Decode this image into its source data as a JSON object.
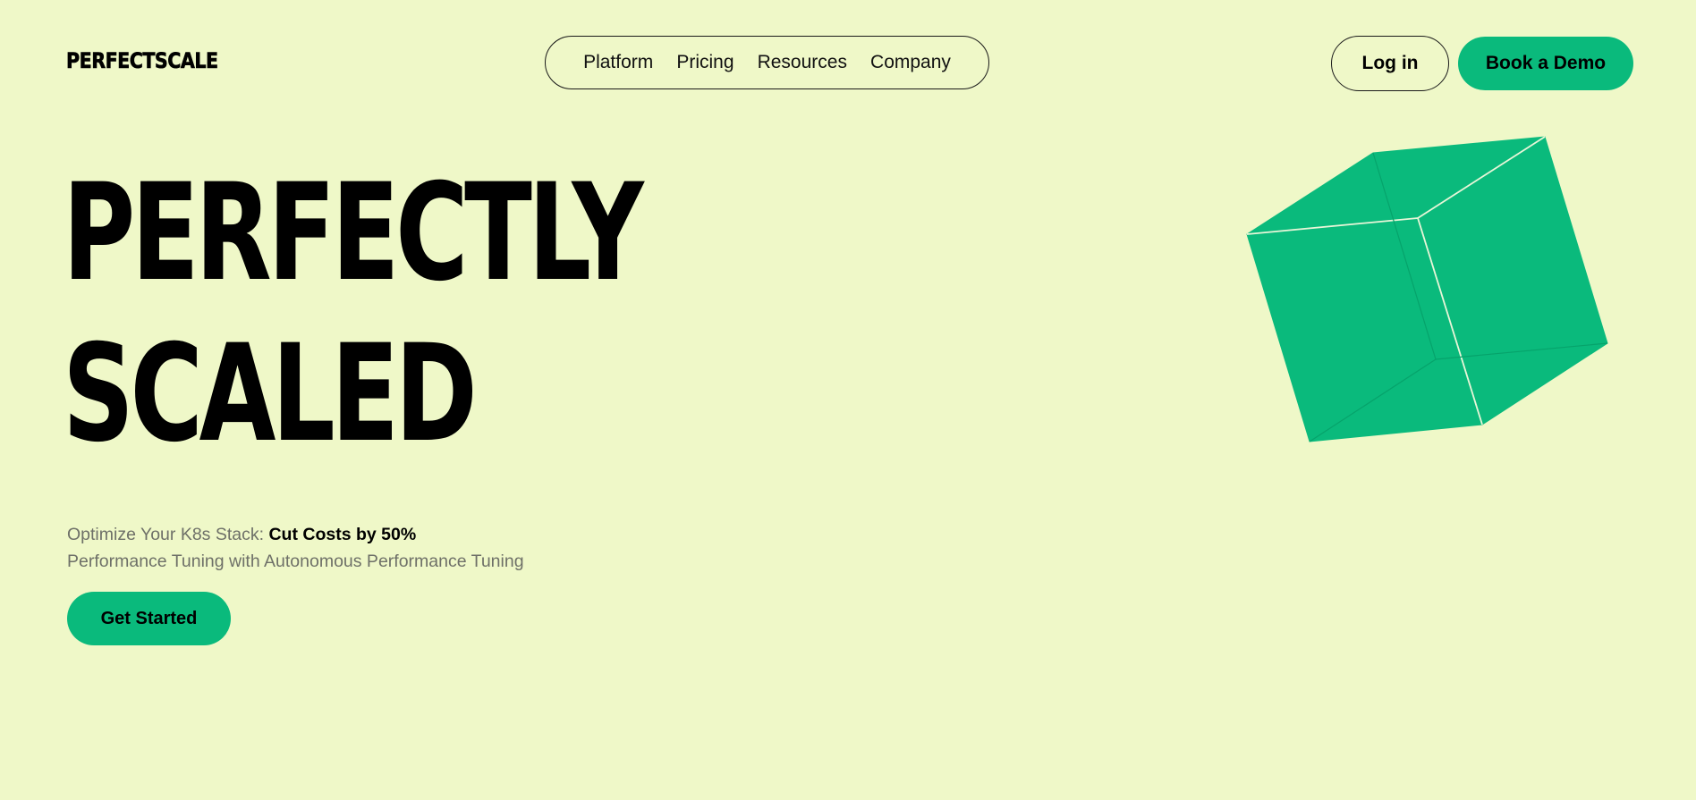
{
  "header": {
    "logo_text": "PERFECTSCALE",
    "nav_items": [
      {
        "label": "Platform"
      },
      {
        "label": "Pricing"
      },
      {
        "label": "Resources"
      },
      {
        "label": "Company"
      }
    ],
    "login_label": "Log in",
    "demo_label": "Book a Demo"
  },
  "hero": {
    "headline_line1": "PERFECTLY",
    "headline_line2": "SCALED",
    "subtitle_prefix": "Optimize Your K8s Stack: ",
    "subtitle_emphasis": "Cut Costs by 50%",
    "subtitle_line2": "Performance Tuning with Autonomous Performance Tuning",
    "cta_label": "Get Started"
  },
  "illustration": {
    "icon": "cube-icon",
    "color": "#0aba7c"
  },
  "colors": {
    "background": "#eff8c8",
    "accent": "#0aba7c",
    "text": "#000000",
    "muted_text": "#6e7068"
  }
}
